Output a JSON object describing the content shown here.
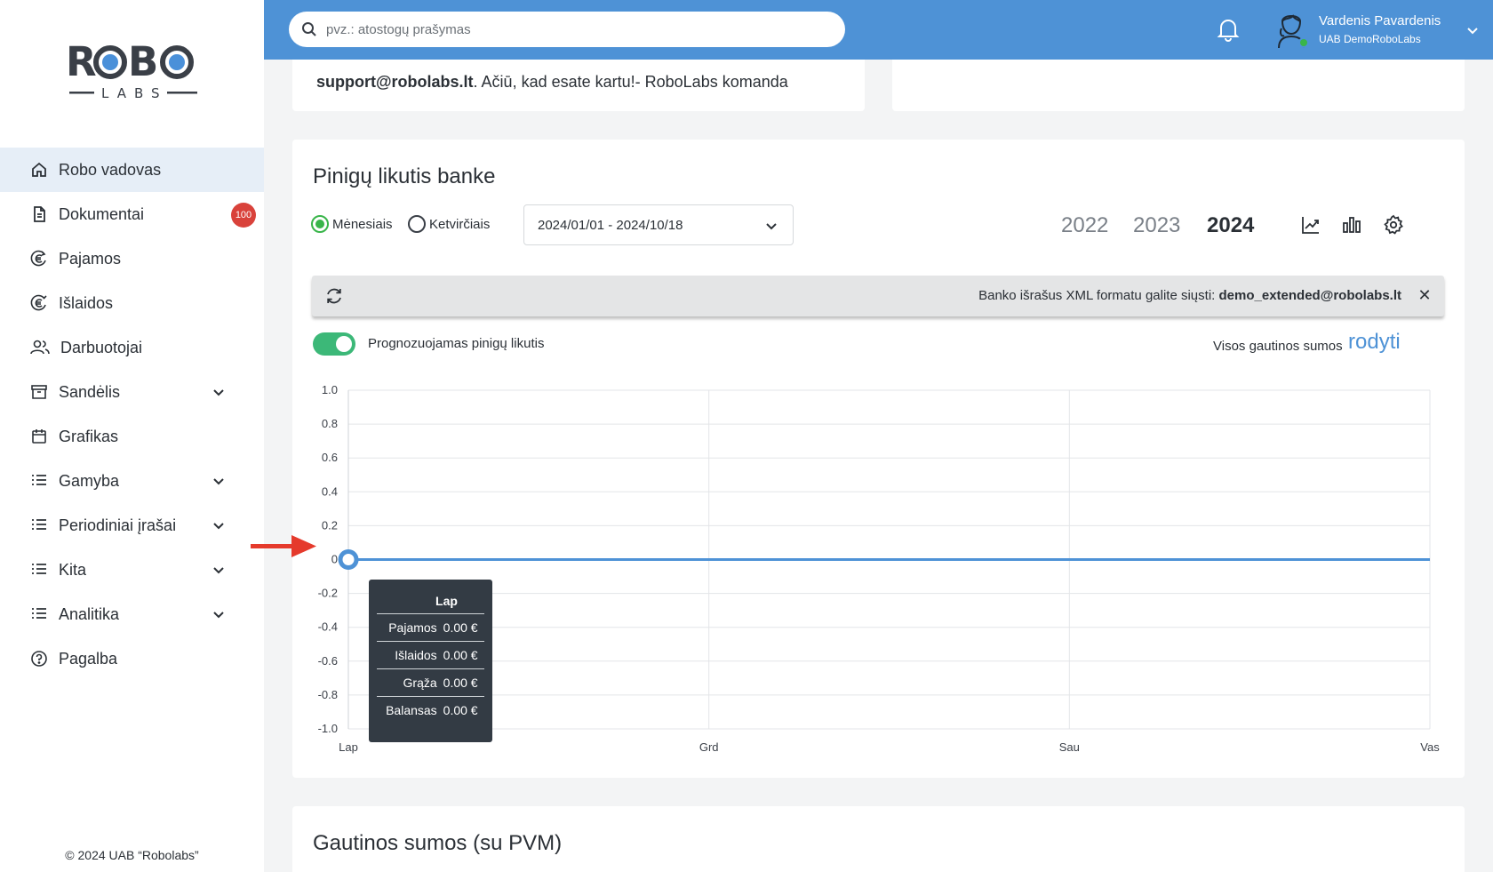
{
  "sidebar": {
    "logo_top": "ROBO",
    "logo_sub": "LABS",
    "items": [
      {
        "label": "Robo vadovas",
        "icon": "home-icon",
        "active": true
      },
      {
        "label": "Dokumentai",
        "icon": "document-icon",
        "badge": "100"
      },
      {
        "label": "Pajamos",
        "icon": "euro-in-icon"
      },
      {
        "label": "Išlaidos",
        "icon": "euro-out-icon"
      },
      {
        "label": "Darbuotojai",
        "icon": "users-icon"
      },
      {
        "label": "Sandėlis",
        "icon": "archive-icon",
        "expandable": true
      },
      {
        "label": "Grafikas",
        "icon": "calendar-icon"
      },
      {
        "label": "Gamyba",
        "icon": "list-icon",
        "expandable": true
      },
      {
        "label": "Periodiniai įrašai",
        "icon": "list-icon",
        "expandable": true
      },
      {
        "label": "Kita",
        "icon": "list-icon",
        "expandable": true
      },
      {
        "label": "Analitika",
        "icon": "list-icon",
        "expandable": true
      },
      {
        "label": "Pagalba",
        "icon": "help-icon"
      }
    ],
    "copyright": "© 2024 UAB “Robolabs”"
  },
  "topbar": {
    "search_placeholder": "pvz.: atostogų prašymas",
    "user_name": "Vardenis Pavardenis",
    "user_company": "UAB DemoRoboLabs",
    "accent": "#4e92d6"
  },
  "notice": {
    "prefix_text": "",
    "email": "support@robolabs.lt",
    "suffix_text": ". Ačiū, kad esate kartu!- RoboLabs komanda"
  },
  "balance_card": {
    "title": "Pinigų likutis banke",
    "period_options": [
      "Mėnesiais",
      "Ketvirčiais"
    ],
    "period_selected": "Mėnesiais",
    "date_range": "2024/01/01 - 2024/10/18",
    "years": [
      "2022",
      "2023",
      "2024"
    ],
    "year_selected": "2024",
    "banner_text": "Banko išrašus XML formatu galite siųsti:",
    "banner_email": "demo_extended@robolabs.lt",
    "toggle_label": "Prognozuojamas pinigų likutis",
    "toggle_on": true,
    "all_sums_label": "Visos gautinos sumos",
    "all_sums_link": "rodyti"
  },
  "chart_data": {
    "type": "line",
    "categories": [
      "Lap",
      "Grd",
      "Sau",
      "Vas"
    ],
    "series": [
      {
        "values": [
          0,
          0,
          0,
          0
        ],
        "color": "#4e92d6"
      }
    ],
    "yticks": [
      "1.0",
      "0.8",
      "0.6",
      "0.4",
      "0.2",
      "0",
      "-0.2",
      "-0.4",
      "-0.6",
      "-0.8",
      "-1.0"
    ],
    "ylim": [
      -1.0,
      1.0
    ],
    "grid": true
  },
  "tooltip": {
    "header": "Lap",
    "rows": [
      {
        "label": "Pajamos",
        "value": "0.00 €"
      },
      {
        "label": "Išlaidos",
        "value": "0.00 €"
      },
      {
        "label": "Grąža",
        "value": "0.00 €"
      },
      {
        "label": "Balansas",
        "value": "0.00 €"
      }
    ]
  },
  "bottom_card": {
    "title": "Gautinos sumos (su PVM)"
  }
}
